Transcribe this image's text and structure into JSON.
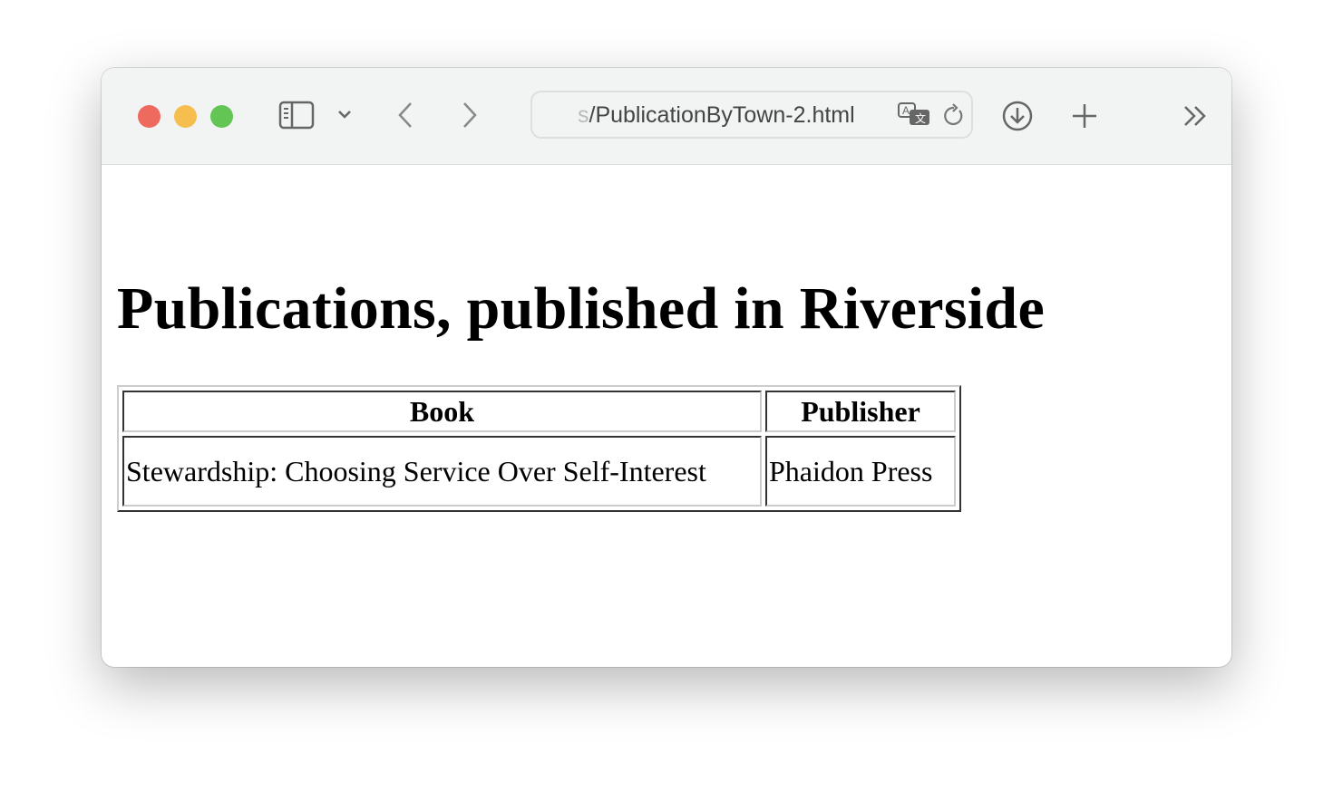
{
  "browser": {
    "url_prefix": "s",
    "url": "/PublicationByTown-2.html",
    "colors": {
      "close": "#ee6a5f",
      "minimize": "#f5be4f",
      "zoom": "#62c554"
    }
  },
  "page": {
    "title": "Publications, published in Riverside",
    "table": {
      "headers": [
        "Book",
        "Publisher"
      ],
      "rows": [
        [
          "Stewardship: Choosing Service Over Self-Interest",
          "Phaidon Press"
        ]
      ]
    }
  }
}
